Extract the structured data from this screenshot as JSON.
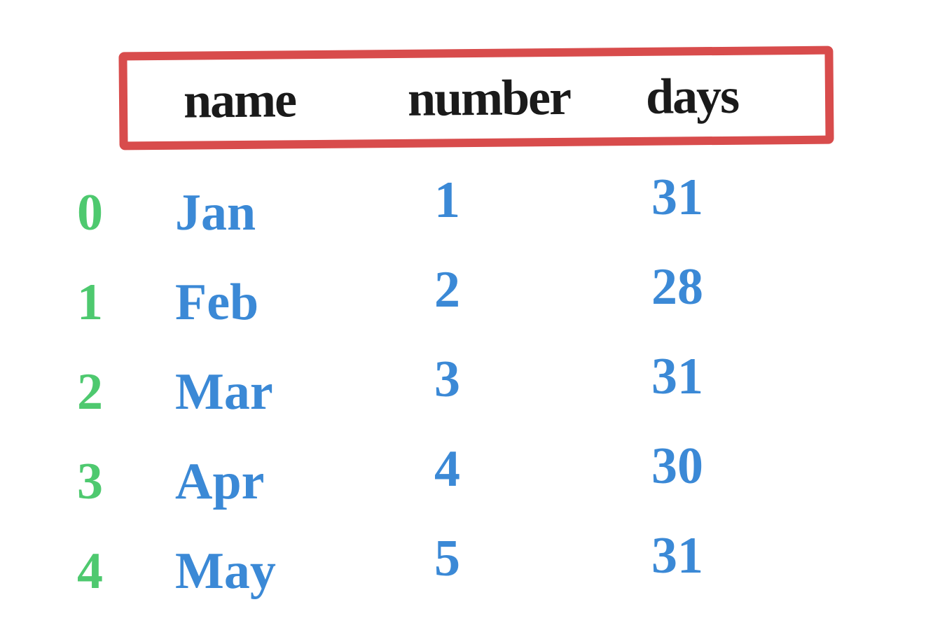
{
  "chart_data": {
    "type": "table",
    "columns": [
      "name",
      "number",
      "days"
    ],
    "index": [
      0,
      1,
      2,
      3,
      4
    ],
    "rows": [
      {
        "name": "Jan",
        "number": 1,
        "days": 31
      },
      {
        "name": "Feb",
        "number": 2,
        "days": 28
      },
      {
        "name": "Mar",
        "number": 3,
        "days": 31
      },
      {
        "name": "Apr",
        "number": 4,
        "days": 30
      },
      {
        "name": "May",
        "number": 5,
        "days": 31
      }
    ]
  },
  "header": {
    "col1": "name",
    "col2": "number",
    "col3": "days"
  },
  "rows": [
    {
      "index": "0",
      "name": "Jan",
      "number": "1",
      "days": "31"
    },
    {
      "index": "1",
      "name": "Feb",
      "number": "2",
      "days": "28"
    },
    {
      "index": "2",
      "name": "Mar",
      "number": "3",
      "days": "31"
    },
    {
      "index": "3",
      "name": "Apr",
      "number": "4",
      "days": "30"
    },
    {
      "index": "4",
      "name": "May",
      "number": "5",
      "days": "31"
    }
  ]
}
